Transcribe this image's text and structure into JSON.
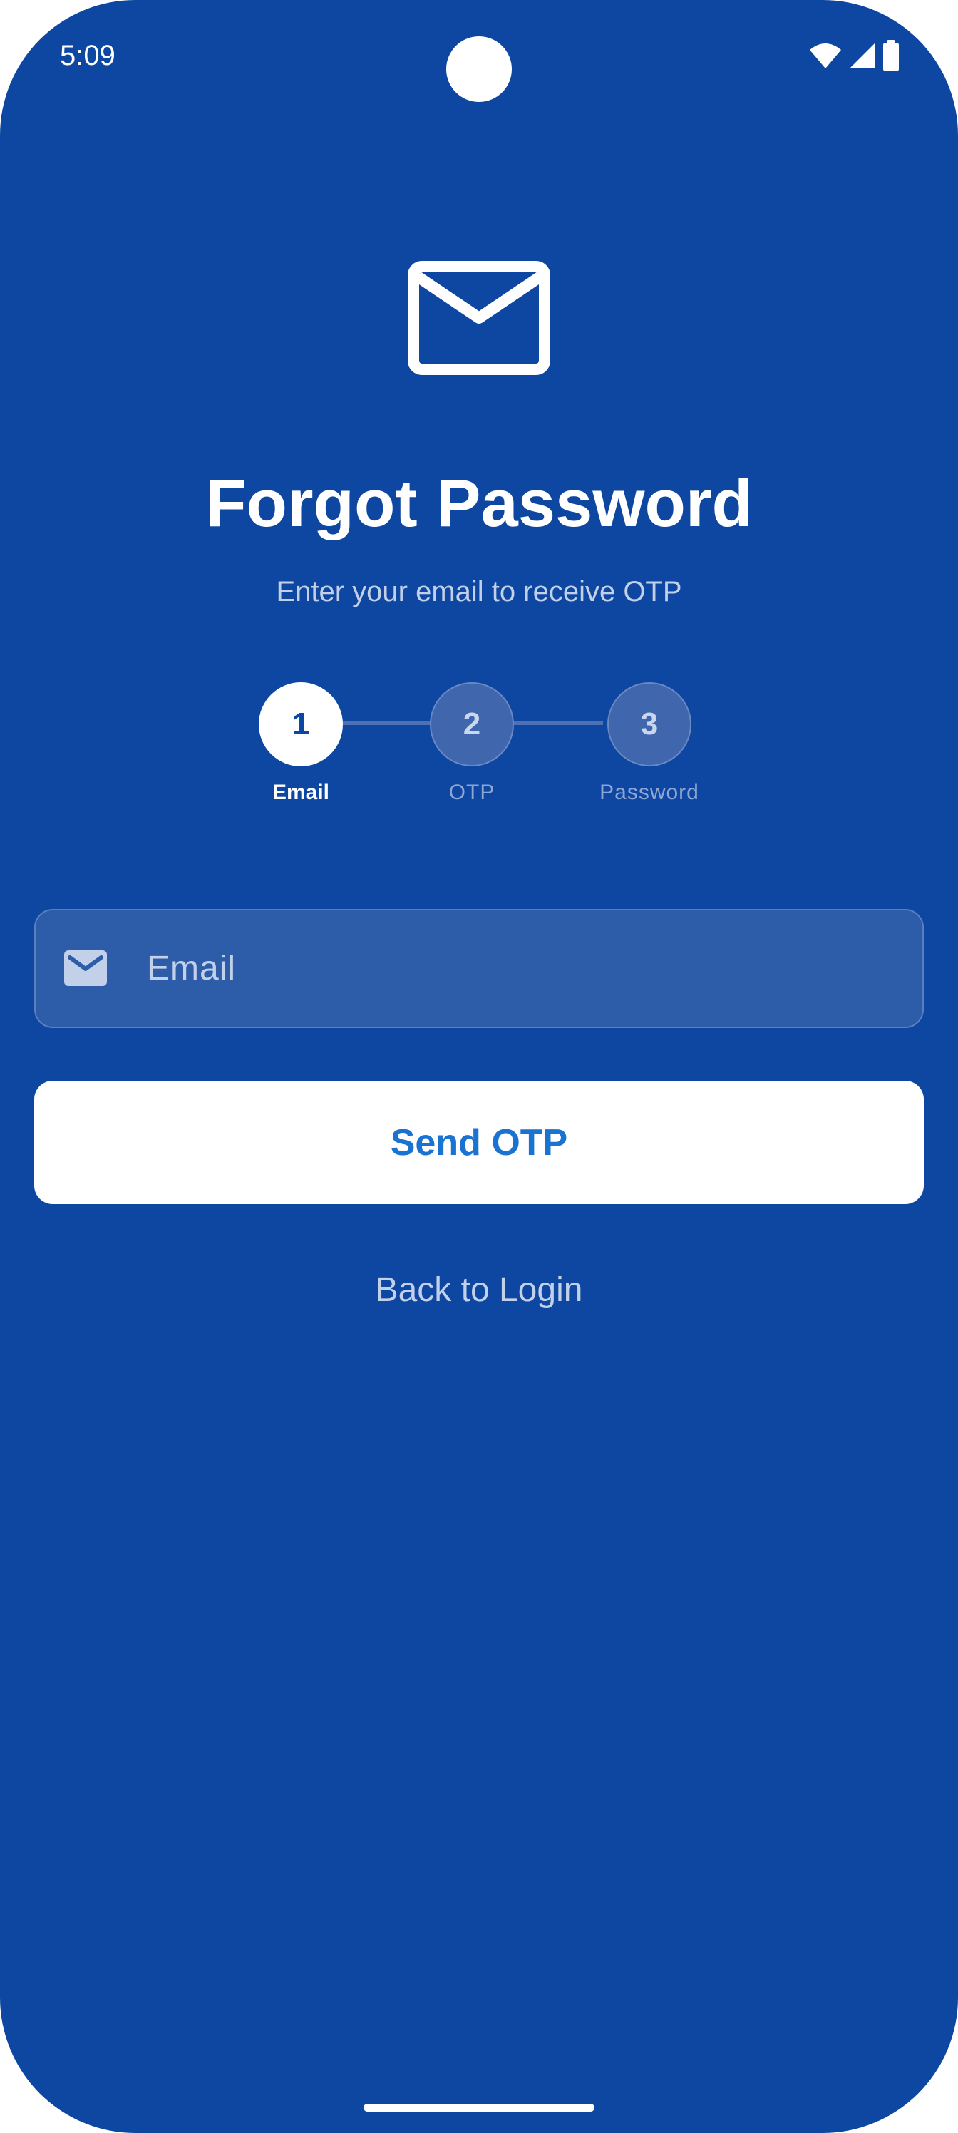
{
  "status_bar": {
    "time": "5:09",
    "icons": [
      "wifi-icon",
      "cellular-signal-icon",
      "battery-icon"
    ]
  },
  "hero": {
    "icon": "envelope-icon",
    "title": "Forgot Password",
    "subtitle": "Enter your email to receive OTP"
  },
  "stepper": {
    "steps": [
      {
        "number": "1",
        "label": "Email",
        "state": "active"
      },
      {
        "number": "2",
        "label": "OTP",
        "state": "inactive"
      },
      {
        "number": "3",
        "label": "Password",
        "state": "inactive"
      }
    ]
  },
  "form": {
    "email_icon": "envelope-icon",
    "email_placeholder": "Email",
    "email_value": "",
    "submit_label": "Send OTP"
  },
  "footer": {
    "back_link": "Back to Login"
  },
  "colors": {
    "background": "#0e47a1",
    "button_text": "#1a73d0",
    "muted_text": "#c3d0ea"
  }
}
